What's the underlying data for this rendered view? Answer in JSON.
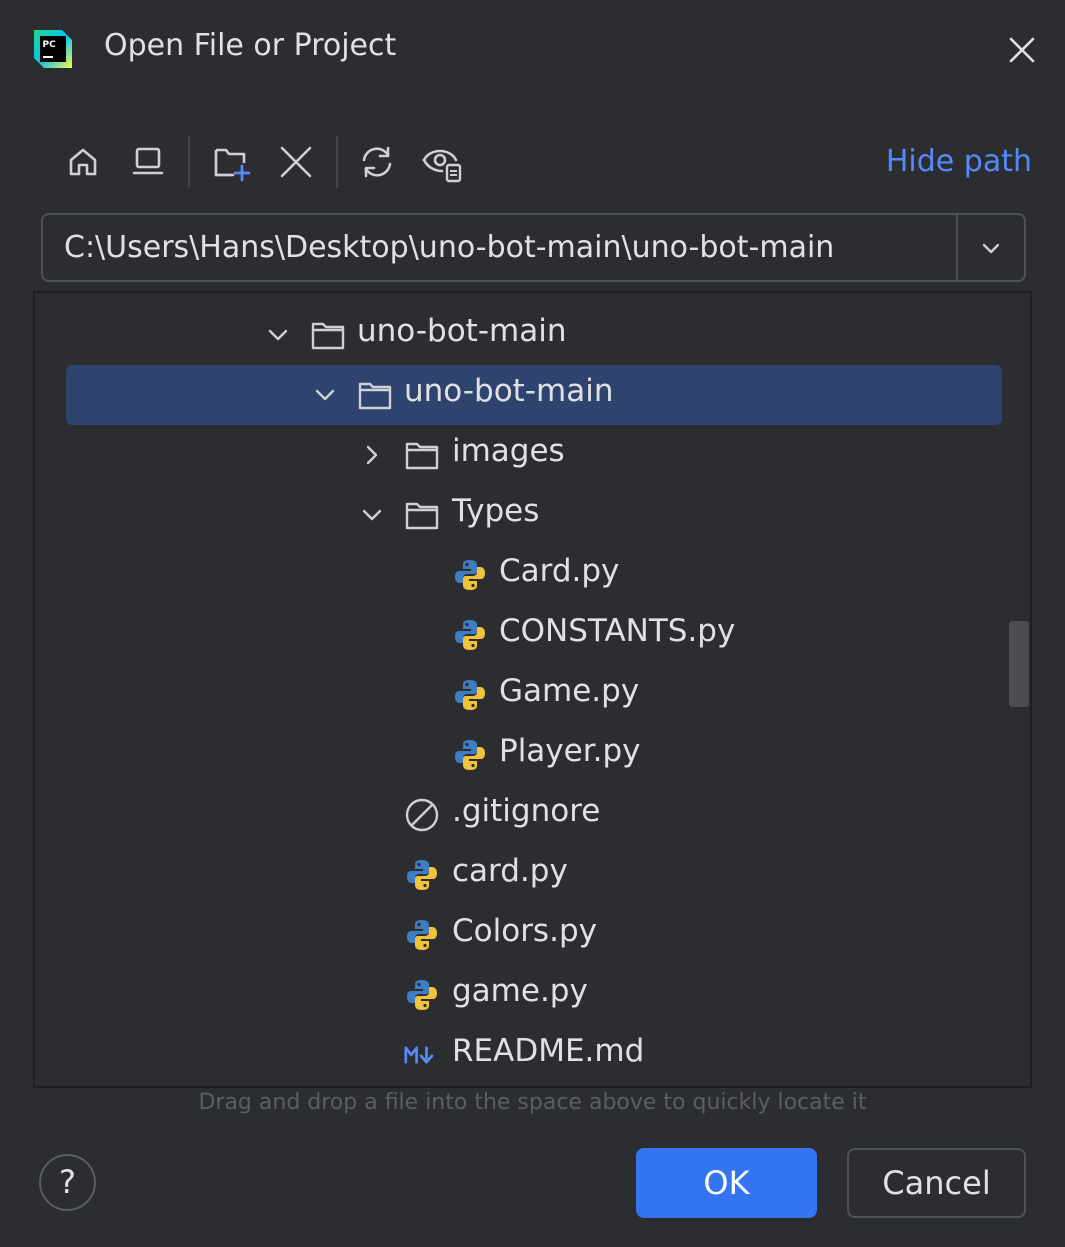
{
  "window": {
    "title": "Open File or Project",
    "app_logo_text": "PC"
  },
  "toolbar": {
    "buttons": [
      {
        "icon": "home-icon"
      },
      {
        "icon": "desktop-icon"
      },
      {
        "icon": "new-folder-icon"
      },
      {
        "icon": "delete-icon"
      },
      {
        "icon": "refresh-icon"
      },
      {
        "icon": "show-hidden-files-icon"
      }
    ],
    "hide_path_label": "Hide path"
  },
  "path": {
    "value": "C:\\Users\\Hans\\Desktop\\uno-bot-main\\uno-bot-main"
  },
  "tree": {
    "rows": [
      {
        "label": "uno-bot-main",
        "icon": "folder-icon",
        "expanded": true,
        "selected": false
      },
      {
        "label": "uno-bot-main",
        "icon": "folder-icon",
        "expanded": true,
        "selected": true
      },
      {
        "label": "images",
        "icon": "folder-icon",
        "expanded": false,
        "selected": false
      },
      {
        "label": "Types",
        "icon": "folder-icon",
        "expanded": true,
        "selected": false
      },
      {
        "label": "Card.py",
        "icon": "python-file-icon",
        "selected": false
      },
      {
        "label": "CONSTANTS.py",
        "icon": "python-file-icon",
        "selected": false
      },
      {
        "label": "Game.py",
        "icon": "python-file-icon",
        "selected": false
      },
      {
        "label": "Player.py",
        "icon": "python-file-icon",
        "selected": false
      },
      {
        "label": ".gitignore",
        "icon": "ignored-file-icon",
        "selected": false
      },
      {
        "label": "card.py",
        "icon": "python-file-icon",
        "selected": false
      },
      {
        "label": "Colors.py",
        "icon": "python-file-icon",
        "selected": false
      },
      {
        "label": "game.py",
        "icon": "python-file-icon",
        "selected": false
      },
      {
        "label": "README.md",
        "icon": "markdown-file-icon",
        "selected": false
      }
    ]
  },
  "hint": "Drag and drop a file into the space above to quickly locate it",
  "buttons": {
    "help_label": "?",
    "ok_label": "OK",
    "cancel_label": "Cancel"
  },
  "colors": {
    "background": "#2b2d30",
    "selection": "#2e436e",
    "accent": "#3574f0",
    "link": "#548af7"
  }
}
